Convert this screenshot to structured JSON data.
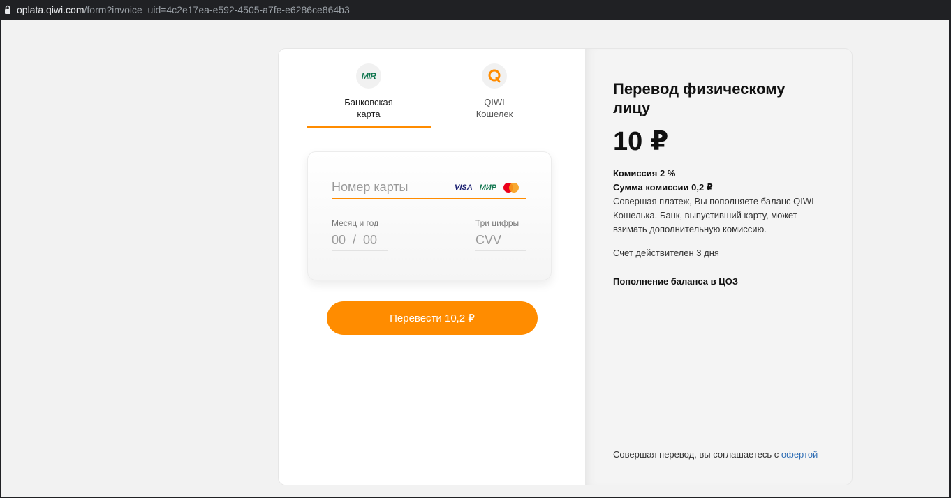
{
  "browser": {
    "url_host": "oplata.qiwi.com",
    "url_path": "/form?invoice_uid=4c2e17ea-e592-4505-a7fe-e6286ce864b3"
  },
  "tabs": [
    {
      "label": "Банковская\nкарта",
      "icon": "mir-icon",
      "active": true
    },
    {
      "label": "QIWI\nКошелек",
      "icon": "qiwi-icon",
      "active": false
    }
  ],
  "mir_logo_text": "MIR",
  "card_form": {
    "number_placeholder": "Номер карты",
    "brand_visa": "VISA",
    "brand_mir": "МИР",
    "month_label": "Месяц и год",
    "month_placeholder": "00  /  00",
    "cvv_label": "Три цифры",
    "cvv_placeholder": "CVV"
  },
  "pay_button": "Перевести 10,2 ₽",
  "summary": {
    "title": "Перевод физическому лицу",
    "amount": "10 ₽",
    "commission": "Комиссия 2 %",
    "commission_sum": "Сумма комиссии 0,2 ₽",
    "description": "Совершая платеж, Вы пополняете баланс QIWI Кошелька. Банк, выпустивший карту, может взимать дополнительную комиссию.",
    "validity": "Счет действителен 3 дня",
    "replenish": "Пополнение баланса в ЦОЗ",
    "agree_text": "Совершая перевод, вы соглашаетесь с ",
    "offer_link": "офертой"
  },
  "colors": {
    "accent": "#ff8c00",
    "link": "#2e6db4"
  }
}
